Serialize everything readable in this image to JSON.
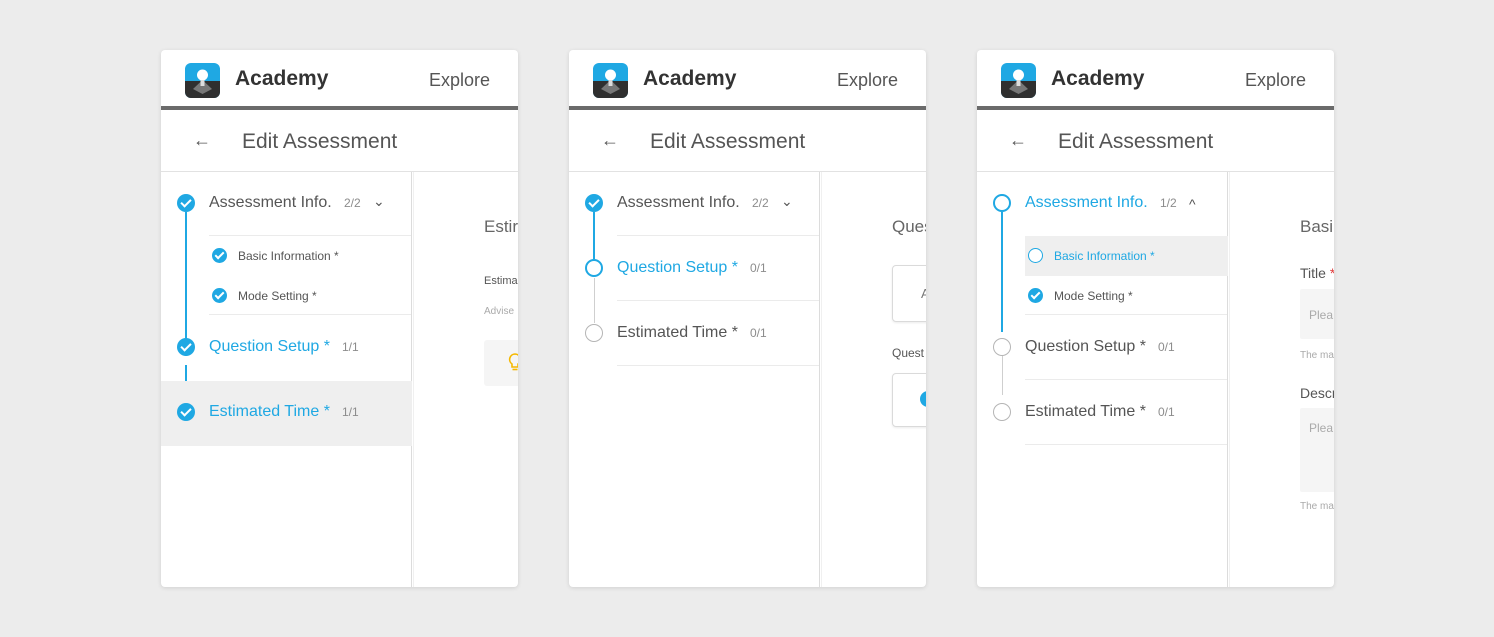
{
  "app": {
    "brand": "Academy",
    "explore": "Explore",
    "page_title": "Edit Assessment",
    "back_glyph": "←"
  },
  "colors": {
    "accent": "#1fa8e3",
    "background": "#ececec",
    "header_rule": "#6b6b6b"
  },
  "panel1": {
    "steps": [
      {
        "label": "Assessment Info.",
        "count": "2/2",
        "chevron": "⌄"
      },
      {
        "label": "Question Setup *",
        "count": "1/1"
      },
      {
        "label": "Estimated Time *",
        "count": "1/1"
      }
    ],
    "substeps": [
      {
        "label": "Basic Information *"
      },
      {
        "label": "Mode Setting *"
      }
    ],
    "content": {
      "title": "Estir",
      "label": "Estima",
      "hint": "Advise"
    }
  },
  "panel2": {
    "steps": [
      {
        "label": "Assessment Info.",
        "count": "2/2",
        "chevron": "⌄"
      },
      {
        "label": "Question Setup *",
        "count": "0/1"
      },
      {
        "label": "Estimated Time *",
        "count": "0/1"
      }
    ],
    "content": {
      "title": "Ques",
      "card_text": "A",
      "label": "Quest"
    }
  },
  "panel3": {
    "steps": [
      {
        "label": "Assessment Info.",
        "count": "1/2",
        "chevron": "^"
      },
      {
        "label": "Question Setup *",
        "count": "0/1"
      },
      {
        "label": "Estimated Time *",
        "count": "0/1"
      }
    ],
    "substeps": [
      {
        "label": "Basic Information *"
      },
      {
        "label": "Mode Setting *"
      }
    ],
    "content": {
      "title": "Basi",
      "title_label": "Title",
      "required_mark": "*",
      "title_placeholder": "Plea",
      "title_hint": "The ma",
      "desc_label": "Descr",
      "desc_placeholder": "Plea",
      "desc_hint": "The ma"
    }
  }
}
